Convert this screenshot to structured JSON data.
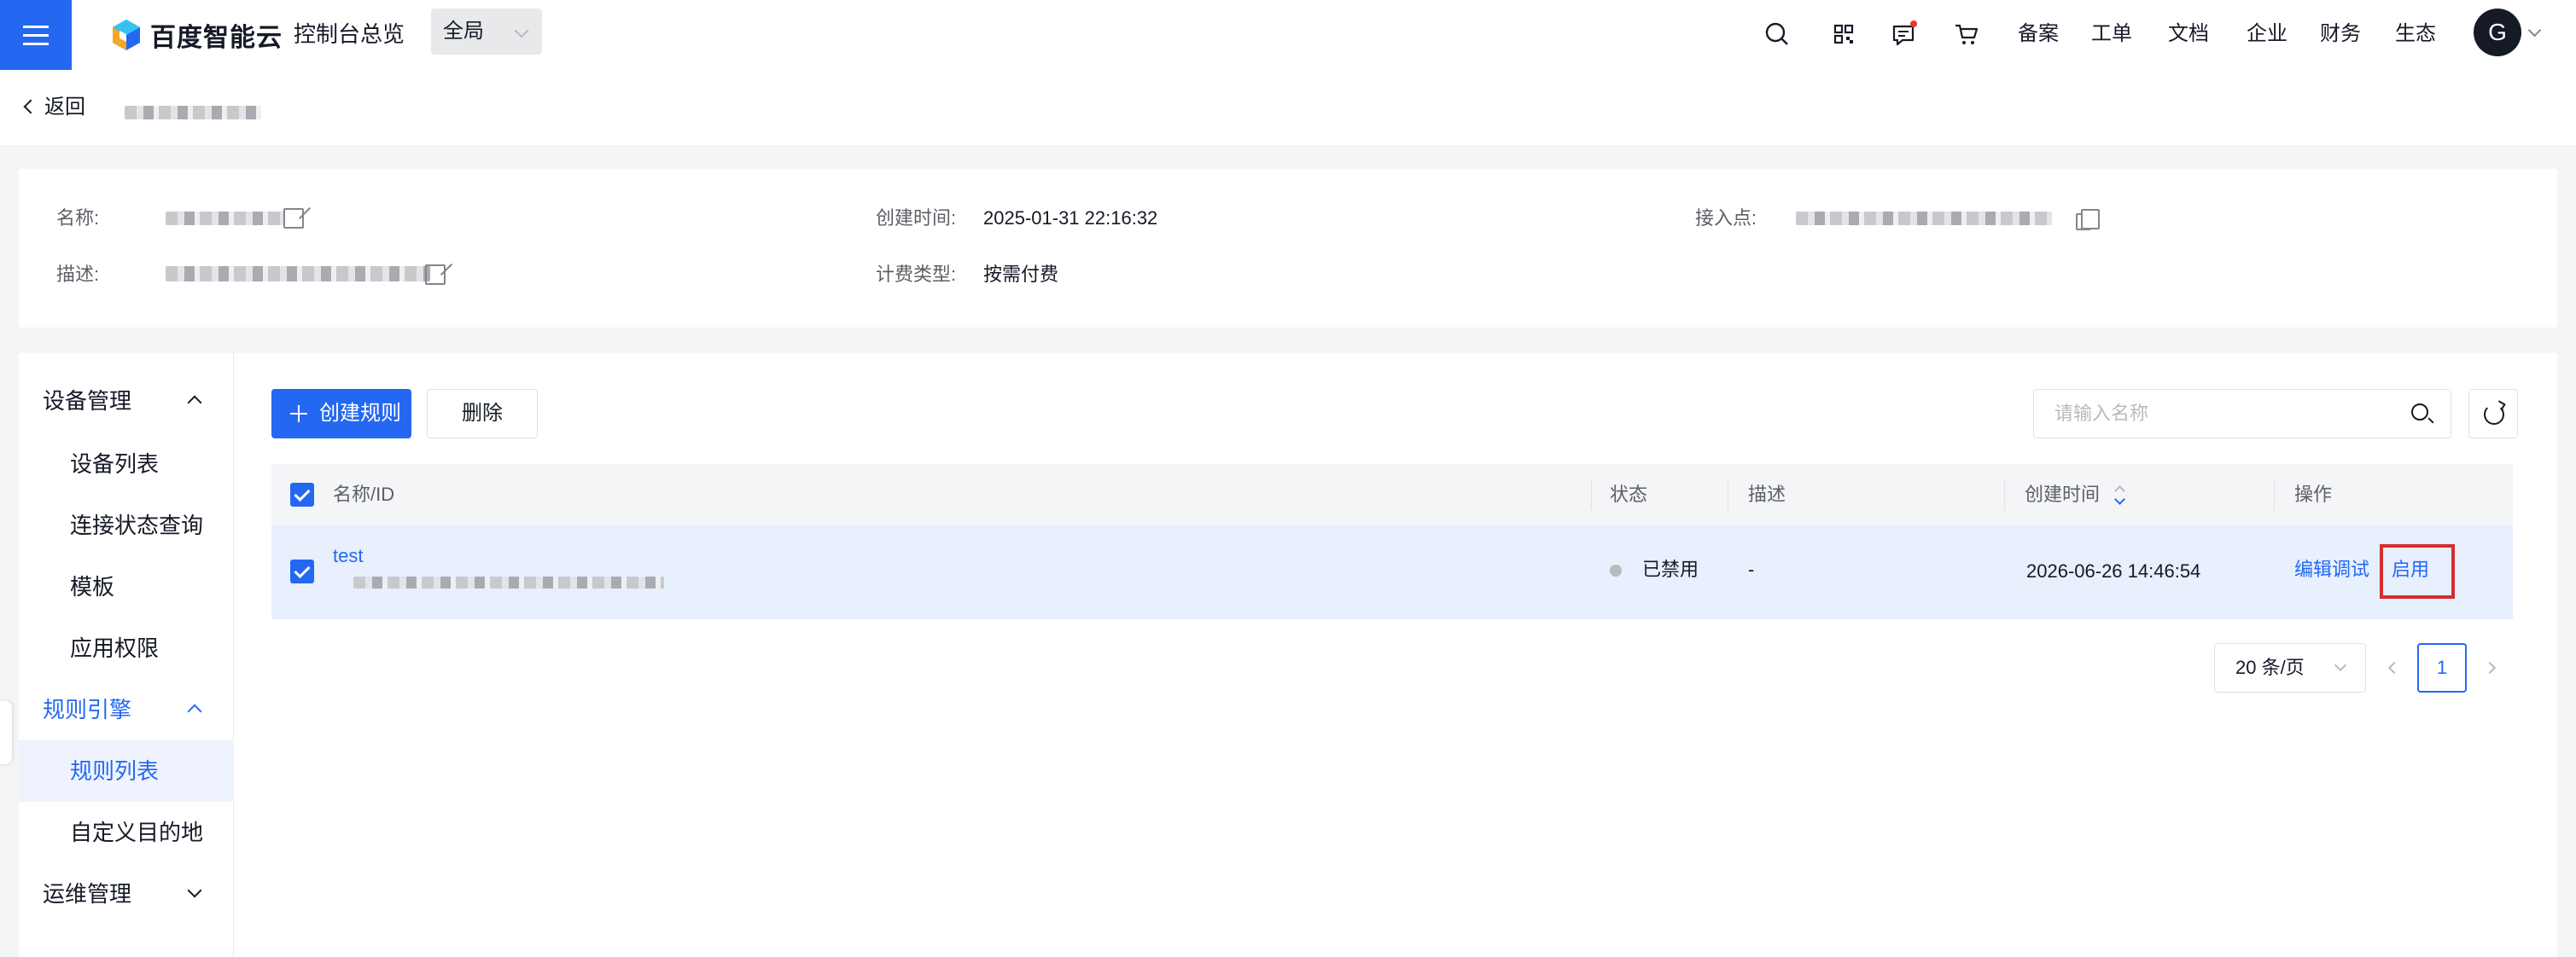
{
  "topbar": {
    "brand": "百度智能云",
    "console_title": "控制台总览",
    "scope": "全局",
    "links": [
      "备案",
      "工单",
      "文档",
      "企业",
      "财务",
      "生态"
    ],
    "avatar_letter": "G",
    "accent_color": "#2468f2"
  },
  "breadcrumb": {
    "back_label": "返回"
  },
  "info": {
    "name_label": "名称:",
    "desc_label": "描述:",
    "created_label": "创建时间:",
    "created_value": "2025-01-31 22:16:32",
    "billing_label": "计费类型:",
    "billing_value": "按需付费",
    "endpoint_label": "接入点:"
  },
  "sidebar": {
    "groups": [
      {
        "label": "设备管理",
        "items": [
          "设备列表",
          "连接状态查询",
          "模板",
          "应用权限"
        ]
      },
      {
        "label": "规则引擎",
        "items": [
          "规则列表",
          "自定义目的地"
        ]
      },
      {
        "label": "运维管理",
        "items": []
      }
    ],
    "selected_item": "规则列表"
  },
  "toolbar": {
    "create_label": "创建规则",
    "delete_label": "删除",
    "search_placeholder": "请输入名称"
  },
  "table": {
    "columns": [
      "名称/ID",
      "状态",
      "描述",
      "创建时间",
      "操作"
    ],
    "rows": [
      {
        "name": "test",
        "status": "已禁用",
        "description": "-",
        "created": "2026-06-26 14:46:54",
        "actions": [
          "编辑调试",
          "启用"
        ]
      }
    ]
  },
  "pagination": {
    "page_size": "20 条/页",
    "current_page": "1"
  }
}
